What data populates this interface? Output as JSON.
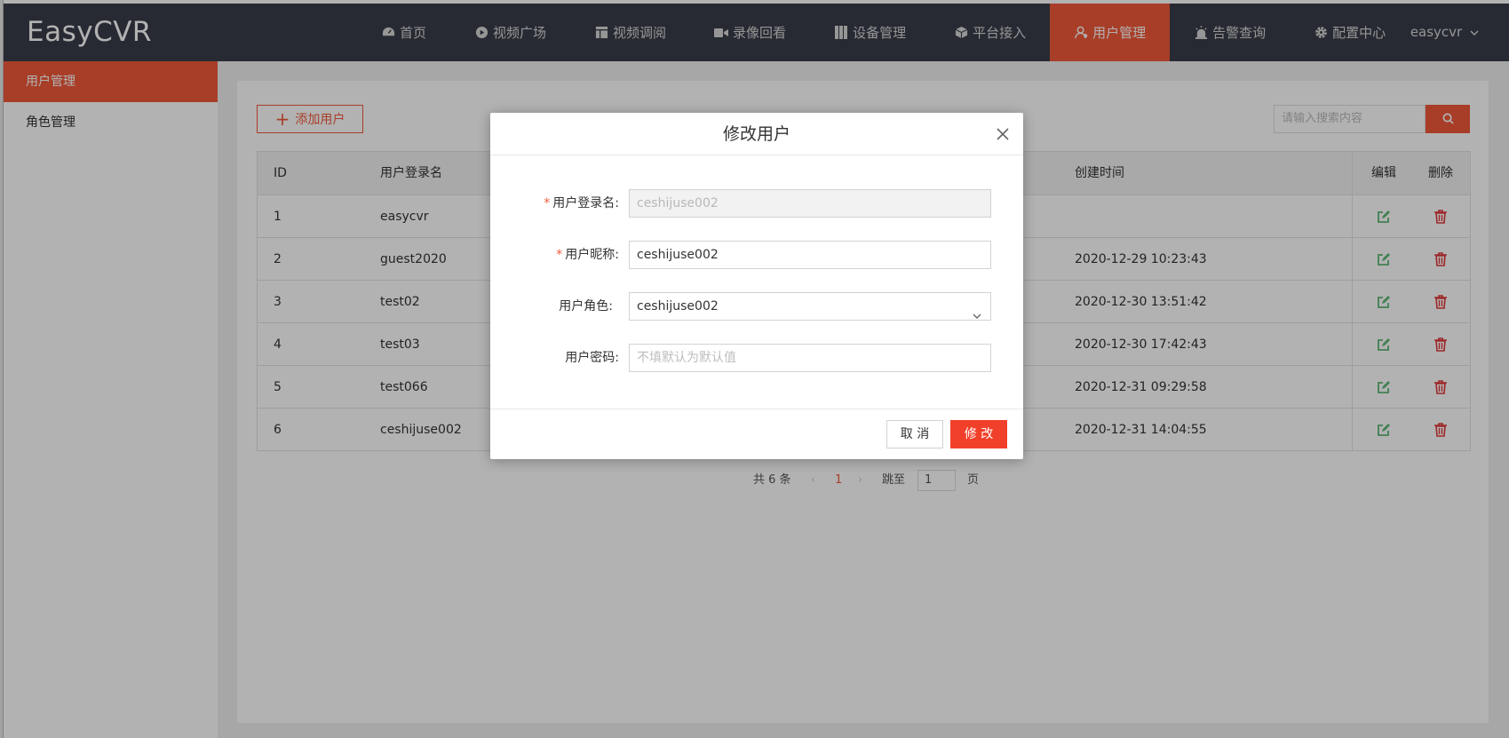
{
  "header": {
    "logo": "EasyCVR",
    "nav": [
      {
        "label": "首页",
        "icon": "dashboard-icon"
      },
      {
        "label": "视频广场",
        "icon": "play-circle-icon"
      },
      {
        "label": "视频调阅",
        "icon": "grid-layout-icon"
      },
      {
        "label": "录像回看",
        "icon": "video-camera-icon"
      },
      {
        "label": "设备管理",
        "icon": "book-icon"
      },
      {
        "label": "平台接入",
        "icon": "cube-icon"
      },
      {
        "label": "用户管理",
        "icon": "user-icon",
        "active": true
      },
      {
        "label": "告警查询",
        "icon": "alarm-icon"
      },
      {
        "label": "配置中心",
        "icon": "gear-icon"
      }
    ],
    "user": "easycvr"
  },
  "sidebar": {
    "items": [
      {
        "label": "用户管理",
        "active": true
      },
      {
        "label": "角色管理"
      }
    ]
  },
  "toolbar": {
    "add_label": "添加用户",
    "search_placeholder": "请输入搜索内容"
  },
  "table": {
    "headers": {
      "id": "ID",
      "name": "用户登录名",
      "time": "创建时间",
      "edit": "编辑",
      "delete": "删除"
    },
    "rows": [
      {
        "id": "1",
        "name": "easycvr",
        "time": ""
      },
      {
        "id": "2",
        "name": "guest2020",
        "time": "2020-12-29 10:23:43"
      },
      {
        "id": "3",
        "name": "test02",
        "time": "2020-12-30 13:51:42"
      },
      {
        "id": "4",
        "name": "test03",
        "time": "2020-12-30 17:42:43"
      },
      {
        "id": "5",
        "name": "test066",
        "time": "2020-12-31 09:29:58"
      },
      {
        "id": "6",
        "name": "ceshijuse002",
        "time": "2020-12-31 14:04:55"
      }
    ]
  },
  "pagination": {
    "total": "共 6 条",
    "prev": "‹",
    "current": "1",
    "next": "›",
    "jump_label": "跳至",
    "jump_value": "1",
    "page_suffix": "页"
  },
  "modal": {
    "title": "修改用户",
    "fields": {
      "login": {
        "label": "用户登录名:",
        "value": "ceshijuse002"
      },
      "nickname": {
        "label": "用户昵称:",
        "value": "ceshijuse002"
      },
      "role": {
        "label": "用户角色:",
        "value": "ceshijuse002"
      },
      "password": {
        "label": "用户密码:",
        "placeholder": "不填默认为默认值"
      }
    },
    "required_mark": "*",
    "cancel": "取 消",
    "submit": "修 改"
  },
  "colors": {
    "header_bg": "#393d49",
    "accent": "#f1593a",
    "edit_icon": "#5fb878",
    "delete_icon": "#e0383a"
  }
}
